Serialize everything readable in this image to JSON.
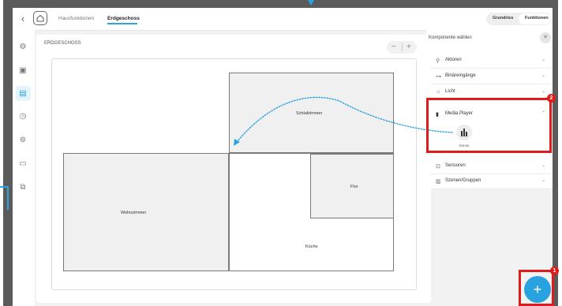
{
  "header": {
    "tabs": [
      {
        "label": "Hausfunktionen"
      },
      {
        "label": "Erdgeschoss"
      }
    ],
    "view_toggle": {
      "options": [
        "Grundriss",
        "Funktionen"
      ],
      "selected": "Funktionen"
    }
  },
  "floorplan": {
    "title": "ERDGESCHOSS",
    "zoom_out": "−",
    "zoom_in": "+",
    "rooms": [
      {
        "name": "Schlafzimmer"
      },
      {
        "name": "Wohnzimmer"
      },
      {
        "name": "Flur"
      },
      {
        "name": "Küche"
      }
    ]
  },
  "panel": {
    "title": "Komponente wählen",
    "close": "✕",
    "categories": [
      {
        "label": "Aktoren",
        "icon": "actuator-icon",
        "expanded": false
      },
      {
        "label": "Binäreingänge",
        "icon": "binary-input-icon",
        "expanded": false
      },
      {
        "label": "Licht",
        "icon": "light-icon",
        "expanded": false
      },
      {
        "label": "Media Player",
        "icon": "media-player-icon",
        "expanded": true
      },
      {
        "label": "Sensoren",
        "icon": "sensor-icon",
        "expanded": false
      },
      {
        "label": "Szenen/Gruppen",
        "icon": "scenes-icon",
        "expanded": false
      }
    ],
    "media_item": {
      "label": "Sonos",
      "icon": "equalizer-icon"
    }
  },
  "callouts": {
    "badge_1": "1",
    "badge_2": "2"
  },
  "fab": {
    "label": "+"
  },
  "colors": {
    "accent": "#29a3e0",
    "highlight": "#e11b1b",
    "frame": "#5b5b5b"
  }
}
